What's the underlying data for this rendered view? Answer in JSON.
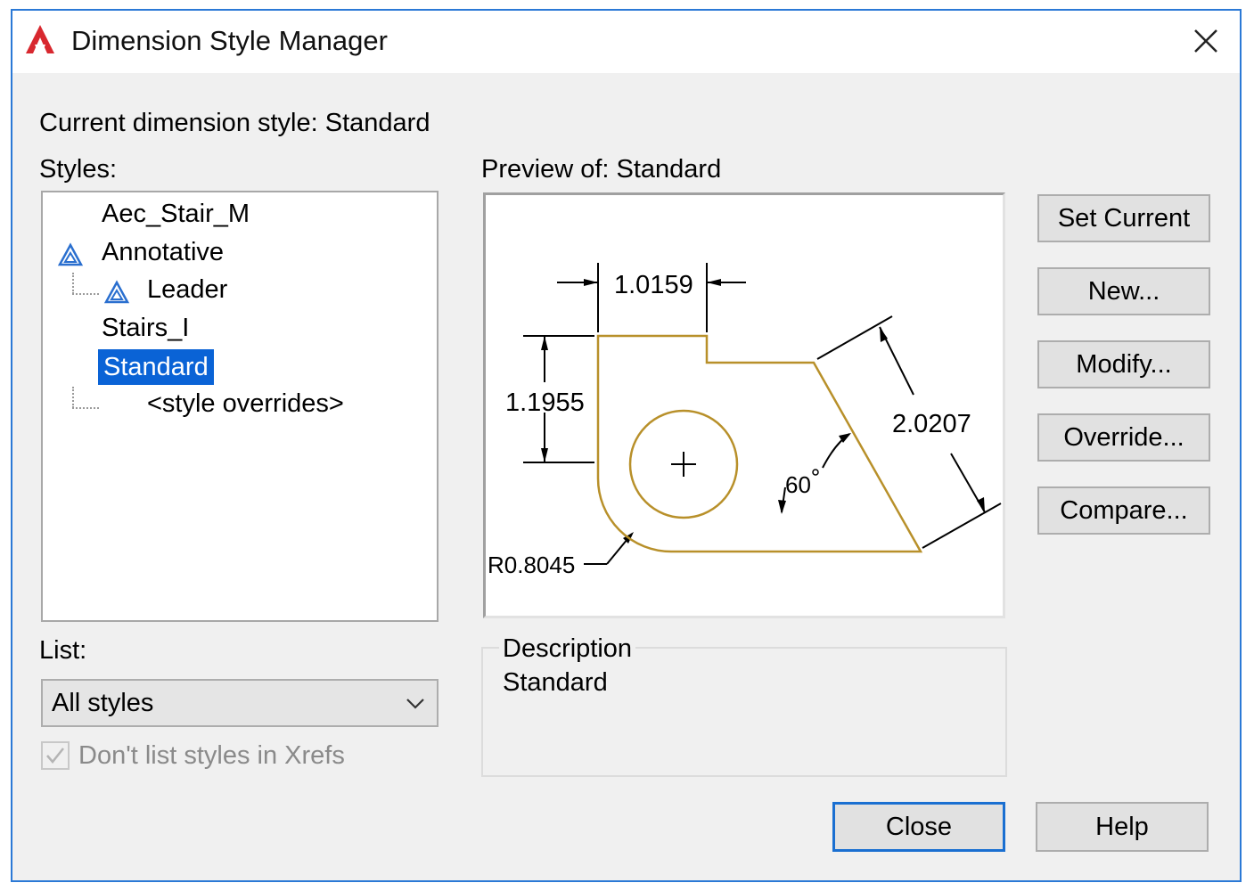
{
  "window": {
    "title": "Dimension Style Manager",
    "close_icon": "close-icon",
    "app_icon": "autocad-logo-icon",
    "accent_color": "#2b79d6"
  },
  "current_style_label": "Current dimension style: Standard",
  "styles_label": "Styles:",
  "styles": [
    {
      "label": "Aec_Stair_M",
      "annotative": false,
      "selected": false
    },
    {
      "label": "Annotative",
      "annotative": true,
      "selected": false
    },
    {
      "label": "Leader",
      "annotative": true,
      "selected": false
    },
    {
      "label": "Stairs_I",
      "annotative": false,
      "selected": false
    },
    {
      "label": "Standard",
      "annotative": false,
      "selected": true
    },
    {
      "label": "<style overrides>",
      "annotative": false,
      "selected": false
    }
  ],
  "list_label": "List:",
  "list_select": {
    "value": "All styles",
    "icon": "chevron-down-icon"
  },
  "xref_checkbox": {
    "label": "Don't list styles in Xrefs",
    "checked": true,
    "enabled": false
  },
  "preview_label": "Preview of: Standard",
  "preview": {
    "dim_top": "1.0159",
    "dim_left": "1.1955",
    "dim_right": "2.0207",
    "angle": "60",
    "radius": "R0.8045",
    "shape_color": "#b8902a"
  },
  "description": {
    "title": "Description",
    "text": "Standard"
  },
  "buttons": {
    "set_current": "Set Current",
    "new": "New...",
    "modify": "Modify...",
    "override": "Override...",
    "compare": "Compare...",
    "close": "Close",
    "help": "Help"
  }
}
